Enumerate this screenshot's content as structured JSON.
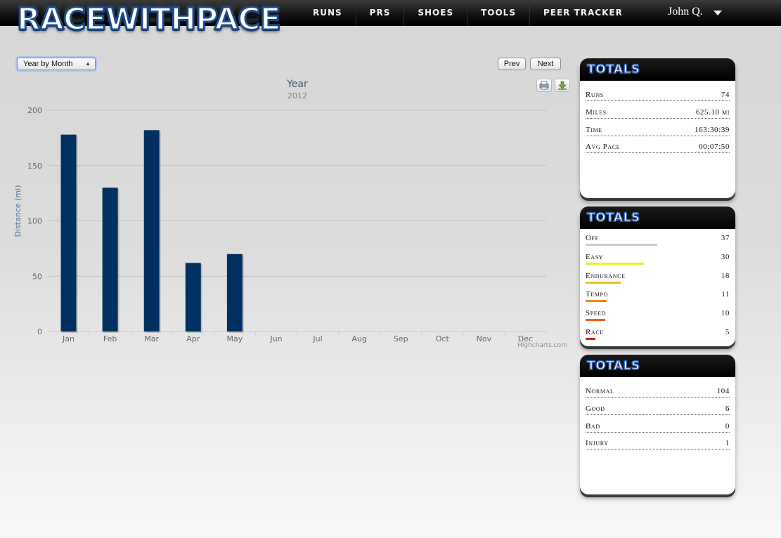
{
  "brand": {
    "logo_text": "RACEWITHPACE"
  },
  "nav": {
    "items": [
      "RUNS",
      "PRs",
      "SHOES",
      "TOOLS",
      "PEER TRACKER"
    ],
    "user": "John Q."
  },
  "controls": {
    "view_select": "Year by Month",
    "prev_label": "Prev",
    "next_label": "Next",
    "print_icon": "printer-icon",
    "export_icon": "download-icon"
  },
  "chart_data": {
    "type": "bar",
    "title": "Year",
    "subtitle": "2012",
    "xlabel": "",
    "ylabel": "Distance (mi)",
    "categories": [
      "Jan",
      "Feb",
      "Mar",
      "Apr",
      "May",
      "Jun",
      "Jul",
      "Aug",
      "Sep",
      "Oct",
      "Nov",
      "Dec"
    ],
    "values": [
      178,
      130,
      182,
      62,
      70,
      null,
      null,
      null,
      null,
      null,
      null,
      null
    ],
    "ylim": [
      0,
      200
    ],
    "yticks": [
      0,
      50,
      100,
      150,
      200
    ],
    "grid": true,
    "legend": "none",
    "bar_color": "#00305f",
    "credits": "Highcharts.com"
  },
  "panels": {
    "totals": {
      "title": "TOTALS",
      "rows": [
        {
          "label": "Runs",
          "value": "74"
        },
        {
          "label": "Miles",
          "value": "625.10 mi"
        },
        {
          "label": "Time",
          "value": "163:30:39"
        },
        {
          "label": "Avg Pace",
          "value": "00:07:50"
        }
      ]
    },
    "run_types": {
      "title": "TOTALS",
      "rows": [
        {
          "label": "Off",
          "value": "37",
          "color": "#cccccc"
        },
        {
          "label": "Easy",
          "value": "30",
          "color": "#f2ef1c"
        },
        {
          "label": "Endurance",
          "value": "18",
          "color": "#e8c21a"
        },
        {
          "label": "Tempo",
          "value": "11",
          "color": "#ef8a17"
        },
        {
          "label": "Speed",
          "value": "10",
          "color": "#e8601a"
        },
        {
          "label": "Race",
          "value": "5",
          "color": "#d8261a"
        }
      ]
    },
    "feel": {
      "title": "TOTALS",
      "rows": [
        {
          "label": "Normal",
          "value": "104"
        },
        {
          "label": "Good",
          "value": "6"
        },
        {
          "label": "Bad",
          "value": "0"
        },
        {
          "label": "Injury",
          "value": "1"
        }
      ]
    }
  }
}
